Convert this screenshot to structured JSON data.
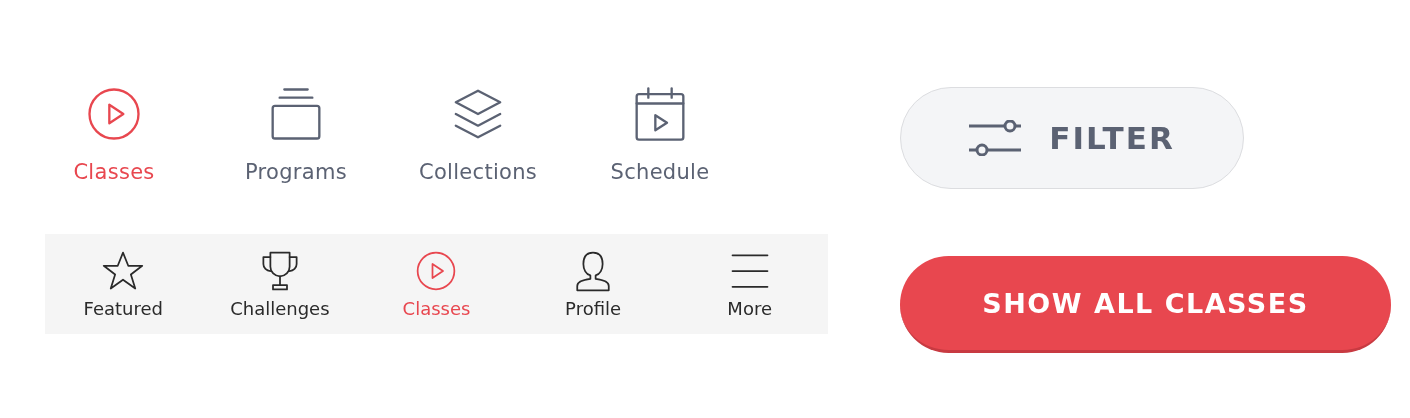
{
  "top_tabs": [
    {
      "kind": "play",
      "label": "Classes",
      "selected": true
    },
    {
      "kind": "stack",
      "label": "Programs",
      "selected": false
    },
    {
      "kind": "layers",
      "label": "Collections",
      "selected": false
    },
    {
      "kind": "calendar",
      "label": "Schedule",
      "selected": false
    }
  ],
  "bottom_nav": [
    {
      "kind": "star",
      "label": "Featured",
      "selected": false
    },
    {
      "kind": "trophy",
      "label": "Challenges",
      "selected": false
    },
    {
      "kind": "play",
      "label": "Classes",
      "selected": true
    },
    {
      "kind": "person",
      "label": "Profile",
      "selected": false
    },
    {
      "kind": "menu",
      "label": "More",
      "selected": false
    }
  ],
  "filter_button": {
    "label": "FILTER"
  },
  "show_all_button": {
    "label": "SHOW ALL CLASSES"
  }
}
